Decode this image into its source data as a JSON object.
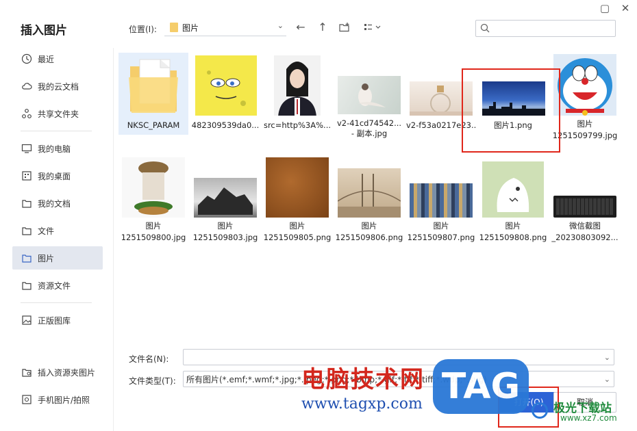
{
  "dialog": {
    "title": "插入图片"
  },
  "window": {
    "maximize_icon": "maximize-icon",
    "close_icon": "close-icon"
  },
  "sidebar": {
    "items": [
      {
        "label": "最近",
        "icon": "clock-icon"
      },
      {
        "label": "我的云文档",
        "icon": "cloud-icon"
      },
      {
        "label": "共享文件夹",
        "icon": "share-icon"
      },
      {
        "label": "我的电脑",
        "icon": "monitor-icon"
      },
      {
        "label": "我的桌面",
        "icon": "desktop-icon"
      },
      {
        "label": "我的文档",
        "icon": "documents-icon"
      },
      {
        "label": "文件",
        "icon": "folder-icon"
      },
      {
        "label": "图片",
        "icon": "picture-folder-icon"
      },
      {
        "label": "资源文件",
        "icon": "folder-icon"
      },
      {
        "label": "正版图库",
        "icon": "gallery-icon"
      },
      {
        "label": "插入资源夹图片",
        "icon": "folder-image-icon"
      },
      {
        "label": "手机图片/拍照",
        "icon": "phone-image-icon"
      }
    ]
  },
  "toolbar": {
    "location_label": "位置(I):",
    "location_value": "图片"
  },
  "files": [
    {
      "name": "NKSC_PARAM",
      "kind": "folder"
    },
    {
      "name": "482309539da0...",
      "kind": "image"
    },
    {
      "name": "src=http%3A%...",
      "kind": "image"
    },
    {
      "name": "v2-41cd74542...",
      "name2": "- 副本.jpg",
      "kind": "image"
    },
    {
      "name": "v2-f53a0217e23...",
      "kind": "image"
    },
    {
      "name": "图片1.png",
      "kind": "image"
    },
    {
      "name": "图片",
      "name2": "1251509799.jpg",
      "kind": "image"
    },
    {
      "name": "图片",
      "name2": "1251509800.jpg",
      "kind": "image"
    },
    {
      "name": "图片",
      "name2": "1251509803.jpg",
      "kind": "image"
    },
    {
      "name": "图片",
      "name2": "1251509805.png",
      "kind": "image"
    },
    {
      "name": "图片",
      "name2": "1251509806.png",
      "kind": "image"
    },
    {
      "name": "图片",
      "name2": "1251509807.png",
      "kind": "image"
    },
    {
      "name": "图片",
      "name2": "1251509808.png",
      "kind": "image"
    },
    {
      "name": "微信截图",
      "name2": "_20230803092...",
      "kind": "image"
    }
  ],
  "form": {
    "filename_label": "文件名(N):",
    "filename_value": "",
    "filetype_label": "文件类型(T):",
    "filetype_value": "所有图片(*.emf;*.wmf;*.jpg;*.jpeg;*.png;*.bmp;*.gif;*.tif;*.tiff;*.wdp;*.svg)"
  },
  "buttons": {
    "open": "打开(O)",
    "cancel": "取消"
  },
  "watermark": {
    "cn": "电脑技术网",
    "url": "www.tagxp.com",
    "tag": "TAG",
    "brand": "极光下载站",
    "brand_url": "www.xz7.com"
  },
  "colors": {
    "accent": "#e0261a",
    "selected_bg": "#e3e7ef",
    "folder": "#f5cd6b"
  }
}
